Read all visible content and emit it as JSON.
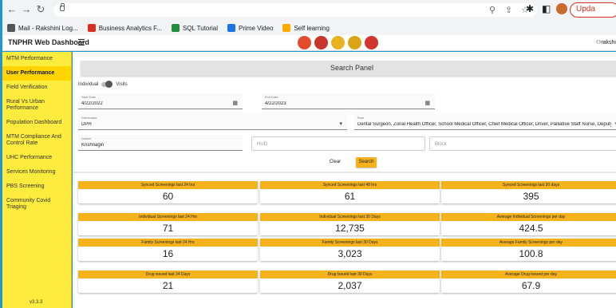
{
  "browser": {
    "update_label": "Upda",
    "bookmarks": [
      {
        "label": "Mail - Rakshini Log...",
        "color": "#555555"
      },
      {
        "label": "Business Analytics F...",
        "color": "#d93025"
      },
      {
        "label": "SQL Tutorial",
        "color": "#1e8e3e"
      },
      {
        "label": "Prime Video",
        "color": "#1a73e8"
      },
      {
        "label": "Self learning",
        "color": "#f9ab00"
      }
    ]
  },
  "header": {
    "title": "TNPHR Web Dashboard",
    "user": "rakshi"
  },
  "sidebar": {
    "items": [
      {
        "label": "MTM Performance",
        "active": false
      },
      {
        "label": "User Performance",
        "active": true
      },
      {
        "label": "Field Verification",
        "active": false
      },
      {
        "label": "Rural Vs Urban Performance",
        "active": false
      },
      {
        "label": "Population Dashboard",
        "active": false
      },
      {
        "label": "MTM Compliance And Control Rate",
        "active": false
      },
      {
        "label": "UHC Performance",
        "active": false
      },
      {
        "label": "Services Monitoring",
        "active": false
      },
      {
        "label": "PBS Screening",
        "active": false
      },
      {
        "label": "Community Covid Triaging",
        "active": false
      }
    ],
    "version": "v3.3.3"
  },
  "panel": {
    "title": "Search Panel",
    "toggle_left": "Individual",
    "toggle_right": "Visits",
    "start_label": "Start Date",
    "start_value": "4/22/2022",
    "end_label": "End Date",
    "end_value": "4/22/2023",
    "directorate_label": "Directorate",
    "directorate_value": "DPH",
    "role_label": "Role",
    "role_value": "Dental Surgeon, Zonal Health Officer, School Medical Officer, Chief Medical Officer, Driver, Palliative Staff Nurse, Deputy Director of Public Health, DPO ...",
    "district_label": "District",
    "district_value": "Krishnagiri",
    "hud_placeholder": "HUD",
    "block_placeholder": "Block",
    "clear_label": "Clear",
    "search_label": "Search"
  },
  "cards": [
    {
      "title": "Synced Screenings last 24 hrs",
      "value": "60"
    },
    {
      "title": "Synced Screenings last 48 hrs",
      "value": "61"
    },
    {
      "title": "Synced Screenings last 30 days",
      "value": "395"
    },
    {
      "title": "Individual Screenings last 24 Hrs",
      "value": "71"
    },
    {
      "title": "Individual Screenings last 30 Days",
      "value": "12,735"
    },
    {
      "title": "Average Individual Screenings per day",
      "value": "424.5"
    },
    {
      "title": "Family Screenings last 24 Hrs",
      "value": "16"
    },
    {
      "title": "Family Screenings last 30 Days",
      "value": "3,023"
    },
    {
      "title": "Average Family Screenings per day",
      "value": "100.8"
    },
    {
      "title": "Drug issued last 24 Days",
      "value": "21"
    },
    {
      "title": "Drug Issued last 30 Days",
      "value": "2,037"
    },
    {
      "title": "Average Drug Issued per day",
      "value": "67.9"
    }
  ]
}
